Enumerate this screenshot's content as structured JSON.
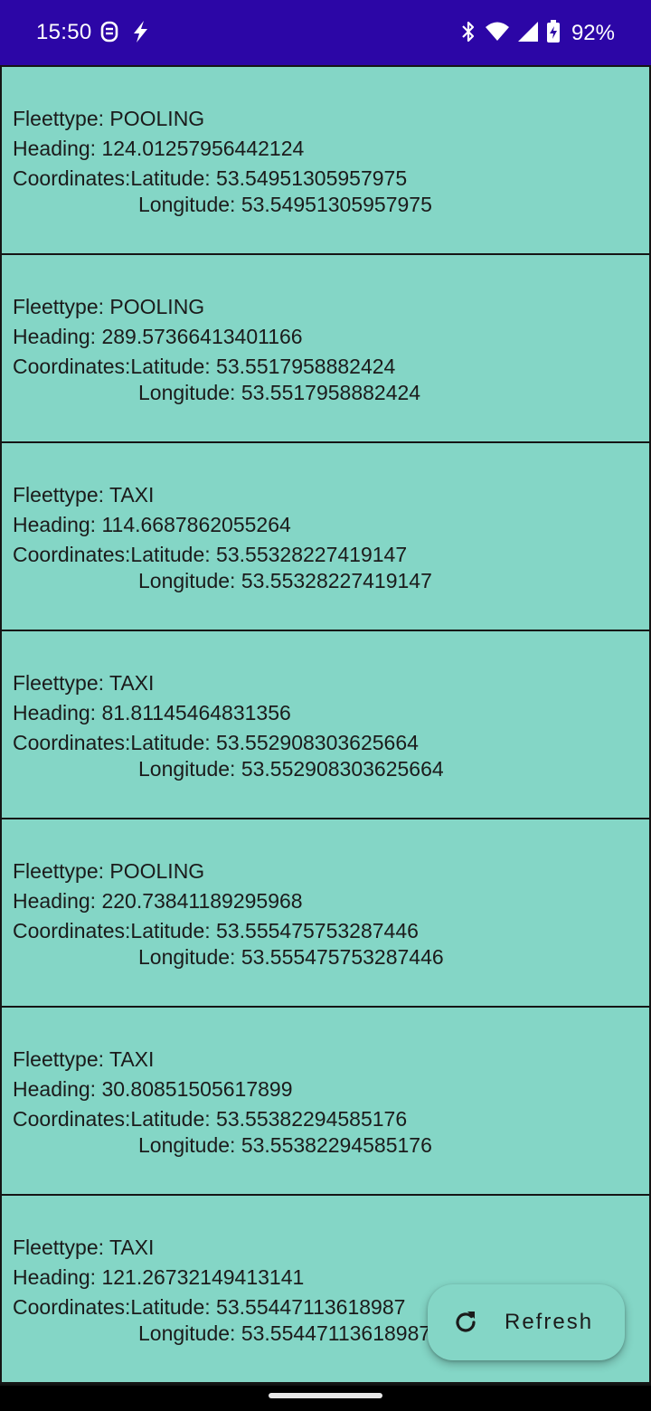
{
  "status_bar": {
    "time": "15:50",
    "battery_percent": "92%",
    "left_icons": [
      "rounded-square-icon",
      "flash-icon"
    ],
    "right_icons": [
      "bluetooth-icon",
      "wifi-icon",
      "cellular-signal-icon",
      "battery-charging-icon"
    ],
    "background_color": "#2c06a6"
  },
  "vehicles": [
    {
      "fleettype": "Fleettype: POOLING",
      "heading": "Heading: 124.01257956442124",
      "coordinates_label": "Coordinates:",
      "latitude": "Latitude: 53.54951305957975",
      "longitude": "Longitude: 53.54951305957975"
    },
    {
      "fleettype": "Fleettype: POOLING",
      "heading": "Heading: 289.57366413401166",
      "coordinates_label": "Coordinates:",
      "latitude": "Latitude: 53.5517958882424",
      "longitude": "Longitude: 53.5517958882424"
    },
    {
      "fleettype": "Fleettype: TAXI",
      "heading": "Heading: 114.6687862055264",
      "coordinates_label": "Coordinates:",
      "latitude": "Latitude: 53.55328227419147",
      "longitude": "Longitude: 53.55328227419147"
    },
    {
      "fleettype": "Fleettype: TAXI",
      "heading": "Heading: 81.81145464831356",
      "coordinates_label": "Coordinates:",
      "latitude": "Latitude: 53.552908303625664",
      "longitude": "Longitude: 53.552908303625664"
    },
    {
      "fleettype": "Fleettype: POOLING",
      "heading": "Heading: 220.73841189295968",
      "coordinates_label": "Coordinates:",
      "latitude": "Latitude: 53.555475753287446",
      "longitude": "Longitude: 53.555475753287446"
    },
    {
      "fleettype": "Fleettype: TAXI",
      "heading": "Heading: 30.80851505617899",
      "coordinates_label": "Coordinates:",
      "latitude": "Latitude: 53.55382294585176",
      "longitude": "Longitude: 53.55382294585176"
    },
    {
      "fleettype": "Fleettype: TAXI",
      "heading": "Heading: 121.26732149413141",
      "coordinates_label": "Coordinates:",
      "latitude": "Latitude: 53.55447113618987",
      "longitude": "Longitude: 53.55447113618987"
    }
  ],
  "fab": {
    "label": "Refresh",
    "icon": "refresh-icon"
  },
  "colors": {
    "card_background": "#84d6c6",
    "card_border": "#151515",
    "text": "#1b1b1b"
  }
}
